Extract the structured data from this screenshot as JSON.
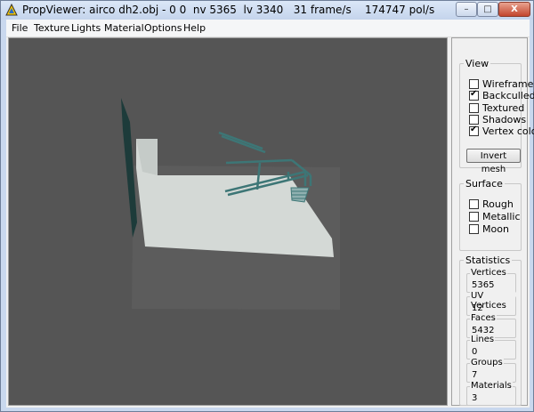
{
  "titlebar": {
    "title": "PropViewer: airco dh2.obj - 0 0  nv 5365  lv 3340   31 frame/s    174747 pol/s",
    "icons": {
      "app": "propviewer-triangle-icon",
      "minimize": "minimize-icon",
      "maximize": "maximize-icon",
      "close": "close-icon"
    },
    "min_glyph": "–",
    "max_glyph": "□",
    "close_glyph": "X"
  },
  "menu": {
    "items": [
      "File",
      "Texture",
      "Lights",
      "Material",
      "Options",
      "Help"
    ]
  },
  "panel": {
    "view": {
      "legend": "View",
      "options": [
        {
          "label": "Wireframe",
          "checked": false
        },
        {
          "label": "Backculled",
          "checked": true
        },
        {
          "label": "Textured",
          "checked": false
        },
        {
          "label": "Shadows",
          "checked": false
        },
        {
          "label": "Vertex color",
          "checked": true
        }
      ],
      "invert_button": "Invert mesh"
    },
    "surface": {
      "legend": "Surface",
      "options": [
        {
          "label": "Rough",
          "checked": false
        },
        {
          "label": "Metallic",
          "checked": false
        },
        {
          "label": "Moon",
          "checked": false
        }
      ]
    },
    "statistics": {
      "legend": "Statistics",
      "items": [
        {
          "label": "Vertices",
          "value": "5365"
        },
        {
          "label": "UV Vertices",
          "value": "12"
        },
        {
          "label": "Faces",
          "value": "5432"
        },
        {
          "label": "Lines",
          "value": "0"
        },
        {
          "label": "Groups",
          "value": "7"
        },
        {
          "label": "Materials",
          "value": "3"
        }
      ]
    }
  },
  "colors": {
    "viewport_bg": "#555555",
    "floor": "#d4d9d6",
    "wall": "#1d3b3a",
    "pipes": "#3d7676"
  }
}
